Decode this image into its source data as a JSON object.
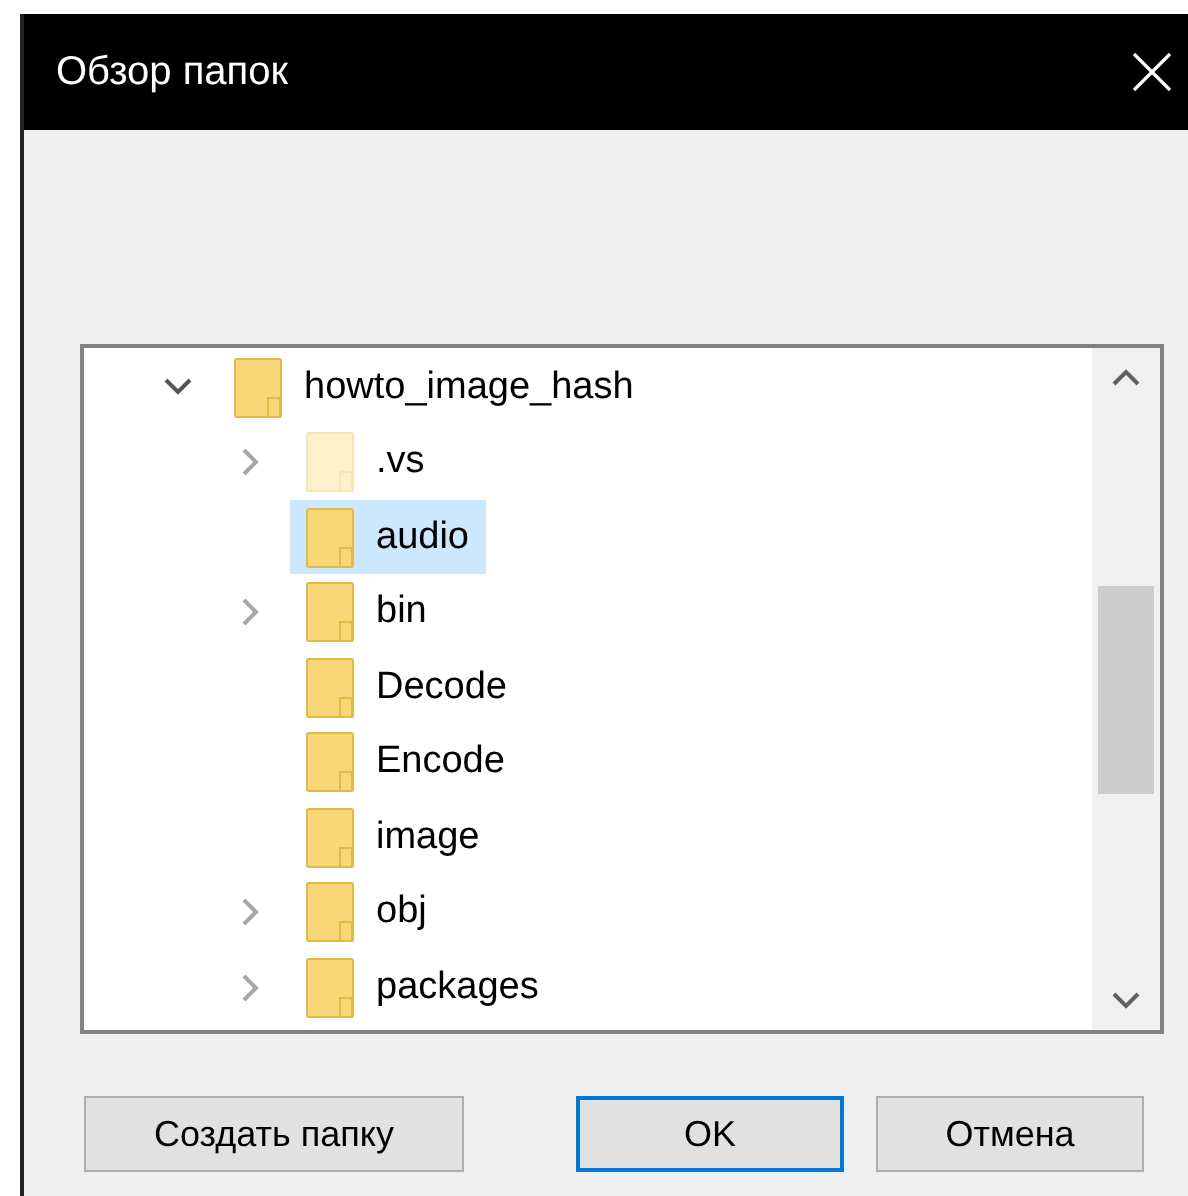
{
  "window": {
    "title": "Обзор папок"
  },
  "tree": {
    "items": [
      {
        "label": "howto_image_hash",
        "expanded": true,
        "selected": false,
        "children": [
          {
            "label": ".vs",
            "expandable": true,
            "faded": true,
            "selected": false
          },
          {
            "label": "audio",
            "expandable": false,
            "faded": false,
            "selected": true
          },
          {
            "label": "bin",
            "expandable": true,
            "faded": false,
            "selected": false
          },
          {
            "label": "Decode",
            "expandable": false,
            "faded": false,
            "selected": false
          },
          {
            "label": "Encode",
            "expandable": false,
            "faded": false,
            "selected": false
          },
          {
            "label": "image",
            "expandable": false,
            "faded": false,
            "selected": false
          },
          {
            "label": "obj",
            "expandable": true,
            "faded": false,
            "selected": false
          },
          {
            "label": "packages",
            "expandable": true,
            "faded": false,
            "selected": false
          }
        ]
      }
    ]
  },
  "buttons": [
    {
      "label": "Создать папку",
      "default": false
    },
    {
      "label": "OK",
      "default": true
    },
    {
      "label": "Отмена",
      "default": false
    }
  ]
}
